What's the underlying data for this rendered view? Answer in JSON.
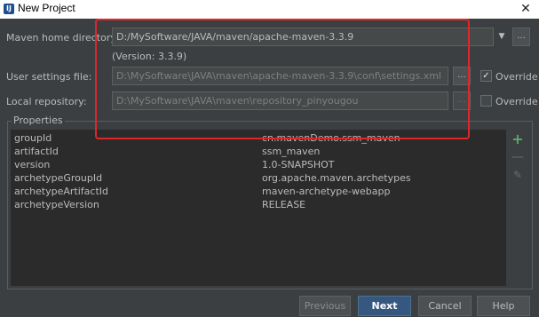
{
  "window": {
    "title": "New Project",
    "close_glyph": "✕",
    "app_icon_letter": "IJ"
  },
  "maven_home": {
    "label": "Maven home directory:",
    "value": "D:/MySoftware/JAVA/maven/apache-maven-3.3.9",
    "dropdown_glyph": "▼",
    "browse_label": "...",
    "version_text": "(Version: 3.3.9)"
  },
  "user_settings": {
    "label": "User settings file:",
    "value": "D:\\MySoftware\\JAVA\\maven\\apache-maven-3.3.9\\conf\\settings.xml",
    "browse_label": "...",
    "override_label": "Override",
    "override_checked": true,
    "check_glyph": "✓"
  },
  "local_repository": {
    "label": "Local repository:",
    "value": "D:\\MySoftware\\JAVA\\maven\\repository_pinyougou",
    "browse_label": "...",
    "override_label": "Override",
    "override_checked": false
  },
  "properties": {
    "legend": "Properties",
    "rows": [
      {
        "key": "groupId",
        "value": "cn.mavenDemo.ssm_maven"
      },
      {
        "key": "artifactId",
        "value": "ssm_maven"
      },
      {
        "key": "version",
        "value": "1.0-SNAPSHOT"
      },
      {
        "key": "archetypeGroupId",
        "value": "org.apache.maven.archetypes"
      },
      {
        "key": "archetypeArtifactId",
        "value": "maven-archetype-webapp"
      },
      {
        "key": "archetypeVersion",
        "value": "RELEASE"
      }
    ],
    "tools": {
      "add_glyph": "+",
      "remove_glyph": "—",
      "edit_glyph": "✎"
    }
  },
  "footer": {
    "previous_label": "Previous",
    "next_label": "Next",
    "cancel_label": "Cancel",
    "help_label": "Help"
  },
  "colors": {
    "background": "#3c3f41",
    "highlight_border": "#e0262b",
    "primary_button": "#365880",
    "add_icon": "#59a869"
  }
}
